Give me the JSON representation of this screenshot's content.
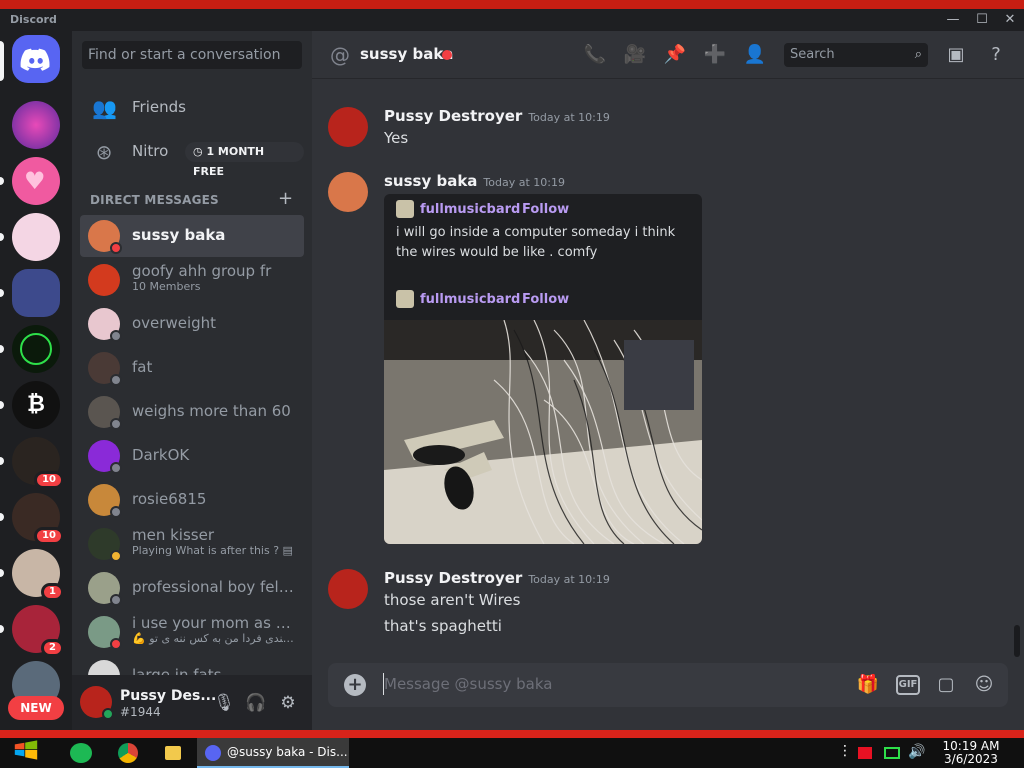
{
  "window": {
    "brand": "Discord",
    "controls": {
      "minimize": "—",
      "maximize": "☐",
      "close": "✕"
    }
  },
  "guild_bar": {
    "badges": [
      "10",
      "10",
      "1",
      "2"
    ],
    "new_label": "NEW"
  },
  "dm_sidebar": {
    "search_placeholder": "Find or start a conversation",
    "friends_label": "Friends",
    "nitro_label": "Nitro",
    "nitro_badge": "1 MONTH FREE",
    "section_header": "DIRECT MESSAGES",
    "conversations": [
      {
        "name": "sussy baka",
        "sub": "",
        "status": "dnd"
      },
      {
        "name": "goofy ahh group fr",
        "sub": "10 Members",
        "status": ""
      },
      {
        "name": "overweight",
        "sub": "",
        "status": "offline"
      },
      {
        "name": "fat",
        "sub": "",
        "status": "offline"
      },
      {
        "name": "weighs more than 60",
        "sub": "",
        "status": "offline"
      },
      {
        "name": "DarkOK",
        "sub": "",
        "status": "offline"
      },
      {
        "name": "rosie6815",
        "sub": "",
        "status": "offline"
      },
      {
        "name": "men kisser",
        "sub": "Playing What is after this ? ▤",
        "status": "idle"
      },
      {
        "name": "professional boy fella...",
        "sub": "",
        "status": "offline"
      },
      {
        "name": "i use your mom as a c...",
        "sub": "💪 من میخندی فردا من به کس ننه ی تو...",
        "status": "dnd"
      },
      {
        "name": "large in fats",
        "sub": "",
        "status": "offline"
      }
    ]
  },
  "user_panel": {
    "username": "Pussy Des...",
    "tag": "#1944"
  },
  "chat": {
    "recipient": "sussy baka",
    "search_placeholder": "Search",
    "messages": [
      {
        "author": "Pussy Destroyer",
        "time": "Today at 10:19",
        "lines": [
          "Yes"
        ]
      },
      {
        "author": "sussy baka",
        "time": "Today at 10:19",
        "lines": []
      },
      {
        "author": "Pussy Destroyer",
        "time": "Today at 10:19",
        "lines": [
          "those aren't Wires",
          "that's spaghetti"
        ]
      }
    ],
    "embed": {
      "user": "fullmusicbard",
      "follow": "Follow",
      "text": "i will go inside a computer someday i think the wires would be like . comfy",
      "user2": "fullmusicbard",
      "follow2": "Follow"
    },
    "composer_placeholder": "Message @sussy baka",
    "gif_label": "GIF"
  },
  "taskbar": {
    "active_window": "@sussy baka - Dis...",
    "time": "10:19 AM",
    "date": "3/6/2023"
  },
  "colors": {
    "blurple": "#5865f2",
    "dnd": "#f23f43",
    "online": "#23a55a",
    "link": "#b99bf2"
  }
}
